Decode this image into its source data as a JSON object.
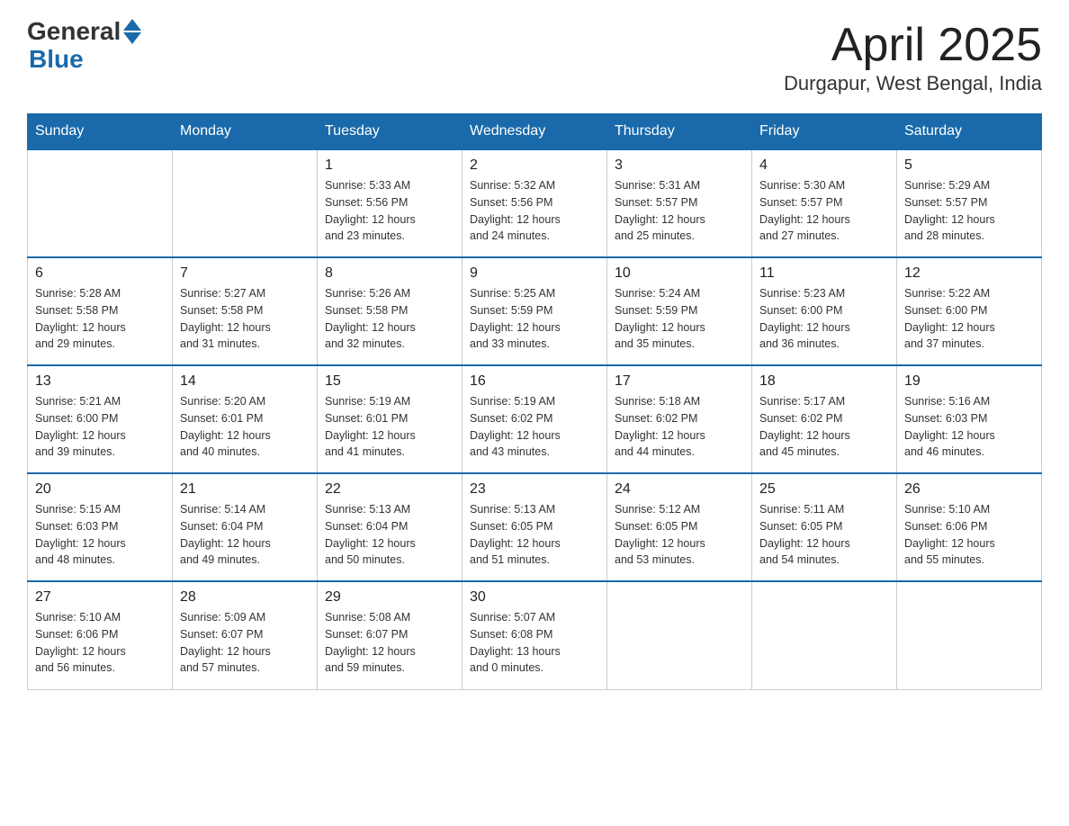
{
  "header": {
    "logo_general": "General",
    "logo_blue": "Blue",
    "title": "April 2025",
    "subtitle": "Durgapur, West Bengal, India"
  },
  "days_of_week": [
    "Sunday",
    "Monday",
    "Tuesday",
    "Wednesday",
    "Thursday",
    "Friday",
    "Saturday"
  ],
  "weeks": [
    [
      {
        "day": "",
        "info": ""
      },
      {
        "day": "",
        "info": ""
      },
      {
        "day": "1",
        "info": "Sunrise: 5:33 AM\nSunset: 5:56 PM\nDaylight: 12 hours\nand 23 minutes."
      },
      {
        "day": "2",
        "info": "Sunrise: 5:32 AM\nSunset: 5:56 PM\nDaylight: 12 hours\nand 24 minutes."
      },
      {
        "day": "3",
        "info": "Sunrise: 5:31 AM\nSunset: 5:57 PM\nDaylight: 12 hours\nand 25 minutes."
      },
      {
        "day": "4",
        "info": "Sunrise: 5:30 AM\nSunset: 5:57 PM\nDaylight: 12 hours\nand 27 minutes."
      },
      {
        "day": "5",
        "info": "Sunrise: 5:29 AM\nSunset: 5:57 PM\nDaylight: 12 hours\nand 28 minutes."
      }
    ],
    [
      {
        "day": "6",
        "info": "Sunrise: 5:28 AM\nSunset: 5:58 PM\nDaylight: 12 hours\nand 29 minutes."
      },
      {
        "day": "7",
        "info": "Sunrise: 5:27 AM\nSunset: 5:58 PM\nDaylight: 12 hours\nand 31 minutes."
      },
      {
        "day": "8",
        "info": "Sunrise: 5:26 AM\nSunset: 5:58 PM\nDaylight: 12 hours\nand 32 minutes."
      },
      {
        "day": "9",
        "info": "Sunrise: 5:25 AM\nSunset: 5:59 PM\nDaylight: 12 hours\nand 33 minutes."
      },
      {
        "day": "10",
        "info": "Sunrise: 5:24 AM\nSunset: 5:59 PM\nDaylight: 12 hours\nand 35 minutes."
      },
      {
        "day": "11",
        "info": "Sunrise: 5:23 AM\nSunset: 6:00 PM\nDaylight: 12 hours\nand 36 minutes."
      },
      {
        "day": "12",
        "info": "Sunrise: 5:22 AM\nSunset: 6:00 PM\nDaylight: 12 hours\nand 37 minutes."
      }
    ],
    [
      {
        "day": "13",
        "info": "Sunrise: 5:21 AM\nSunset: 6:00 PM\nDaylight: 12 hours\nand 39 minutes."
      },
      {
        "day": "14",
        "info": "Sunrise: 5:20 AM\nSunset: 6:01 PM\nDaylight: 12 hours\nand 40 minutes."
      },
      {
        "day": "15",
        "info": "Sunrise: 5:19 AM\nSunset: 6:01 PM\nDaylight: 12 hours\nand 41 minutes."
      },
      {
        "day": "16",
        "info": "Sunrise: 5:19 AM\nSunset: 6:02 PM\nDaylight: 12 hours\nand 43 minutes."
      },
      {
        "day": "17",
        "info": "Sunrise: 5:18 AM\nSunset: 6:02 PM\nDaylight: 12 hours\nand 44 minutes."
      },
      {
        "day": "18",
        "info": "Sunrise: 5:17 AM\nSunset: 6:02 PM\nDaylight: 12 hours\nand 45 minutes."
      },
      {
        "day": "19",
        "info": "Sunrise: 5:16 AM\nSunset: 6:03 PM\nDaylight: 12 hours\nand 46 minutes."
      }
    ],
    [
      {
        "day": "20",
        "info": "Sunrise: 5:15 AM\nSunset: 6:03 PM\nDaylight: 12 hours\nand 48 minutes."
      },
      {
        "day": "21",
        "info": "Sunrise: 5:14 AM\nSunset: 6:04 PM\nDaylight: 12 hours\nand 49 minutes."
      },
      {
        "day": "22",
        "info": "Sunrise: 5:13 AM\nSunset: 6:04 PM\nDaylight: 12 hours\nand 50 minutes."
      },
      {
        "day": "23",
        "info": "Sunrise: 5:13 AM\nSunset: 6:05 PM\nDaylight: 12 hours\nand 51 minutes."
      },
      {
        "day": "24",
        "info": "Sunrise: 5:12 AM\nSunset: 6:05 PM\nDaylight: 12 hours\nand 53 minutes."
      },
      {
        "day": "25",
        "info": "Sunrise: 5:11 AM\nSunset: 6:05 PM\nDaylight: 12 hours\nand 54 minutes."
      },
      {
        "day": "26",
        "info": "Sunrise: 5:10 AM\nSunset: 6:06 PM\nDaylight: 12 hours\nand 55 minutes."
      }
    ],
    [
      {
        "day": "27",
        "info": "Sunrise: 5:10 AM\nSunset: 6:06 PM\nDaylight: 12 hours\nand 56 minutes."
      },
      {
        "day": "28",
        "info": "Sunrise: 5:09 AM\nSunset: 6:07 PM\nDaylight: 12 hours\nand 57 minutes."
      },
      {
        "day": "29",
        "info": "Sunrise: 5:08 AM\nSunset: 6:07 PM\nDaylight: 12 hours\nand 59 minutes."
      },
      {
        "day": "30",
        "info": "Sunrise: 5:07 AM\nSunset: 6:08 PM\nDaylight: 13 hours\nand 0 minutes."
      },
      {
        "day": "",
        "info": ""
      },
      {
        "day": "",
        "info": ""
      },
      {
        "day": "",
        "info": ""
      }
    ]
  ]
}
